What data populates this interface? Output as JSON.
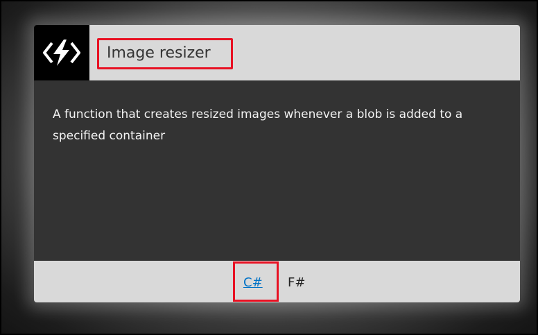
{
  "card": {
    "title": "Image resizer",
    "description": "A function that creates resized images whenever a blob is added to a specified container",
    "icon": "azure-functions-bolt-icon",
    "languages": [
      "C#",
      "F#"
    ],
    "selected_language": "C#"
  },
  "colors": {
    "header_bg": "#d9d9d9",
    "body_bg": "#333333",
    "icon_bg": "#000000",
    "highlight": "#e81123",
    "link": "#0072c6"
  }
}
